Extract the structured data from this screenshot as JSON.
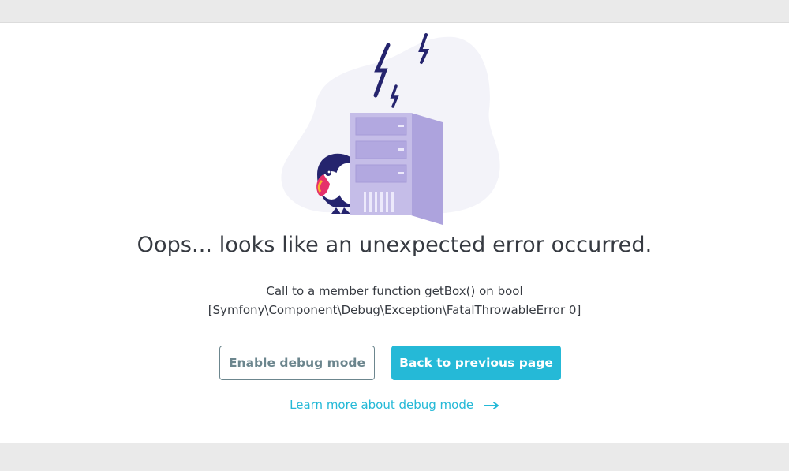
{
  "error": {
    "headline": "Oops... looks like an unexpected error occurred.",
    "message_line1": "Call to a member function getBox() on bool",
    "message_line2": "[Symfony\\Component\\Debug\\Exception\\FatalThrowableError 0]"
  },
  "actions": {
    "debug_label": "Enable debug mode",
    "back_label": "Back to previous page",
    "learn_more_label": "Learn more about debug mode"
  },
  "colors": {
    "accent": "#25b9d7",
    "secondary": "#6c868e",
    "text": "#363a41",
    "server": "#c5bde8",
    "blob": "#f3f3f9",
    "lightning": "#25246e"
  },
  "icons": {
    "illustration": "puffin-server-error-illustration",
    "learn_more": "arrow-right-icon"
  }
}
